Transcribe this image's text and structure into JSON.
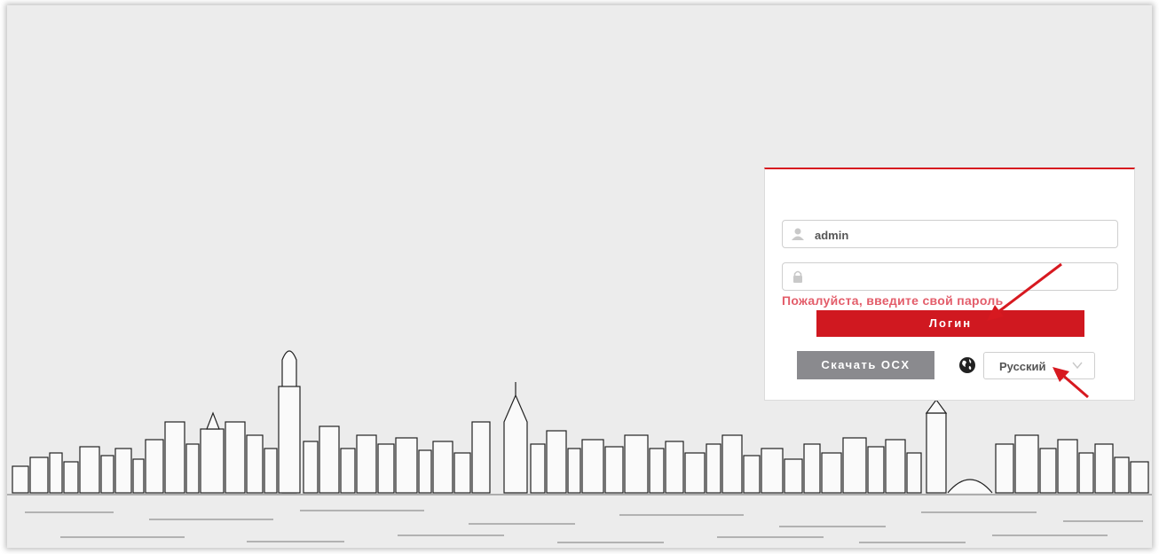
{
  "login": {
    "username_value": "admin",
    "password_value": "",
    "error_message": "Пожалуйста, введите свой пароль",
    "login_label": "Логин",
    "download_ocx_label": "Скачать OCX",
    "language": "Русский"
  },
  "icons": {
    "username": "user-icon",
    "password": "lock-icon",
    "language": "globe-icon",
    "dropdown": "chevron-down-icon"
  },
  "colors": {
    "accent": "#d01820",
    "error_text": "#e35d6a",
    "secondary_button": "#8a8a8e",
    "annotation_arrow": "#d71920"
  }
}
